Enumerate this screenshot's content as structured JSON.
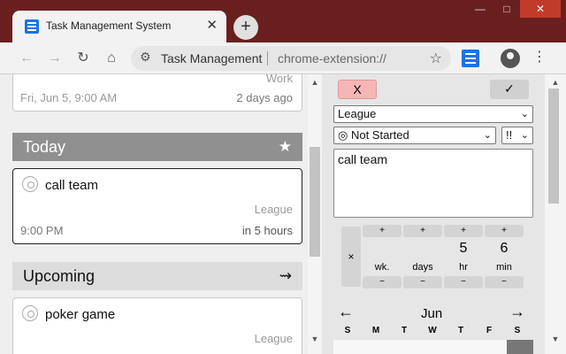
{
  "browser": {
    "tab_title": "Task Management System",
    "tab_close": "✕",
    "new_tab": "+",
    "omnibox_title": "Task Management",
    "omnibox_url": "chrome-extension://"
  },
  "tasks": {
    "first": {
      "category": "Work",
      "date": "Fri, Jun 5, 9:00 AM",
      "relative": "2 days ago"
    },
    "today_header": "Today",
    "today_task": {
      "title": "call team",
      "category": "League",
      "time": "9:00 PM",
      "relative": "in 5 hours"
    },
    "upcoming_header": "Upcoming",
    "upcoming_task": {
      "title": "poker game",
      "category": "League"
    }
  },
  "editor": {
    "cancel_label": "X",
    "confirm_label": "✓",
    "category_value": "League",
    "status_value": "◎ Not Started",
    "priority_value": "!!",
    "description": "call team",
    "reset_label": "×",
    "steppers": [
      {
        "value": "",
        "unit": "wk."
      },
      {
        "value": "",
        "unit": "days"
      },
      {
        "value": "5",
        "unit": "hr"
      },
      {
        "value": "6",
        "unit": "min"
      }
    ],
    "stepper_plus": "+",
    "stepper_minus": "−",
    "calendar": {
      "prev": "←",
      "next": "→",
      "month": "Jun",
      "weekdays": [
        "S",
        "M",
        "T",
        "W",
        "T",
        "F",
        "S"
      ]
    }
  }
}
